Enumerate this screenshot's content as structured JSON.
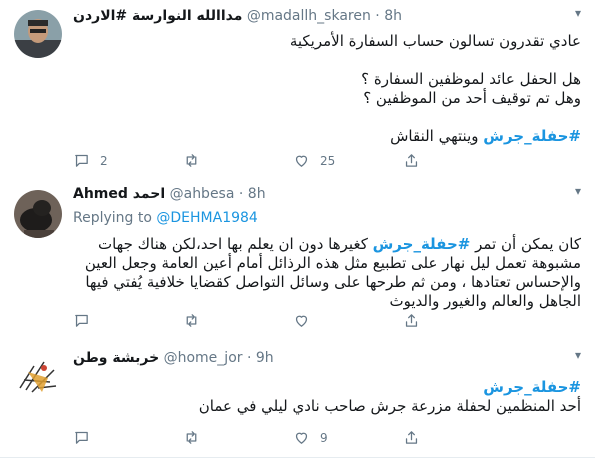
{
  "tweets": [
    {
      "name": "مداالله النوارسة #الاردن",
      "handle": "@madallh_skaren",
      "dot": "·",
      "time": "8h",
      "lines": [
        "عادي تقدرون تسالون حساب السفارة الأمريكية",
        "هل الحفل عائد لموظفين السفارة ؟",
        "وهل تم توقيف أحد من الموظفين ؟"
      ],
      "hashtag": "#حفلة_جرش",
      "hashtag_suffix": " وينتهي النقاش",
      "replies": "2",
      "retweets": "",
      "likes": "25"
    },
    {
      "name": "Ahmed احمد",
      "handle": "@ahbesa",
      "dot": "·",
      "time": "8h",
      "replying_label": "Replying to",
      "replying_handle": "@DEHMA1984",
      "text_before": "كان يمكن أن تمر ",
      "hashtag": "#حفلة_جرش",
      "text_after": " كغيرها دون ان يعلم بها احد،لكن هناك جهات مشبوهة تعمل ليل نهار على تطبيع مثل هذه الرذائل أمام أعين العامة وجعل العين والإحساس تعتادها ، ومن ثم طرحها على وسائل التواصل كقضايا خلافية يُفتي فيها الجاهل والعالم والغيور والديوث",
      "replies": "",
      "retweets": "",
      "likes": ""
    },
    {
      "name": "خربشة وطن",
      "handle": "@home_jor",
      "dot": "·",
      "time": "9h",
      "hashtag": "#حفلة_جرش",
      "line": "أحد المنظمين لحفلة مزرعة جرش صاحب نادي ليلي في عمان",
      "replies": "",
      "retweets": "",
      "likes": "9"
    }
  ],
  "icons": {
    "caret": "chevron-down-icon",
    "reply": "reply-icon",
    "retweet": "retweet-icon",
    "like": "heart-icon",
    "share": "share-icon"
  },
  "colors": {
    "link": "#1b95e0",
    "muted": "#657786",
    "text": "#14171a",
    "divider": "#e6ecf0"
  }
}
